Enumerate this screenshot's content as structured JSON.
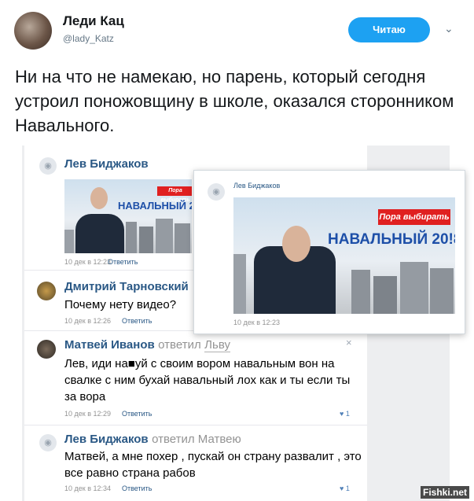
{
  "tweet": {
    "display_name": "Леди Кац",
    "handle": "@lady_Katz",
    "follow_label": "Читаю",
    "text": "Ни на что не намекаю, но парень, который сегодня устроил поножовщину в школе, оказался сторонником Навального."
  },
  "vk": {
    "post": {
      "author": "Лев Биджаков",
      "banner_tag": "Пора выбирать",
      "banner_title": "НАВАЛЬНЫЙ 20",
      "date": "10 дек в 12:23",
      "reply_label": "Ответить"
    },
    "popup": {
      "author": "Лев Биджаков",
      "banner_tag": "Пора выбирать",
      "banner_title": "НАВАЛЬНЫЙ 20!8",
      "date": "10 дек в 12:23"
    },
    "comments": [
      {
        "author": "Дмитрий Тарновский",
        "text": "Почему нету видео?",
        "date": "10 дек в 12:26",
        "reply_label": "Ответить"
      },
      {
        "author": "Матвей Иванов",
        "replied": "ответил",
        "replied_to": "Льву",
        "text": "Лев, иди на■уй с своим вором навальным вон на свалке с ним бухай навальный лох как и ты если ты за вора",
        "date": "10 дек в 12:29",
        "reply_label": "Ответить",
        "likes": "1",
        "close": "×"
      },
      {
        "author": "Лев Биджаков",
        "replied": "ответил Матвею",
        "text": "Матвей, а мне похер , пускай он страну развалит , это все равно страна рабов",
        "date": "10 дек в 12:34",
        "reply_label": "Ответить",
        "likes": "1"
      }
    ]
  },
  "watermark": "Fishki.net"
}
